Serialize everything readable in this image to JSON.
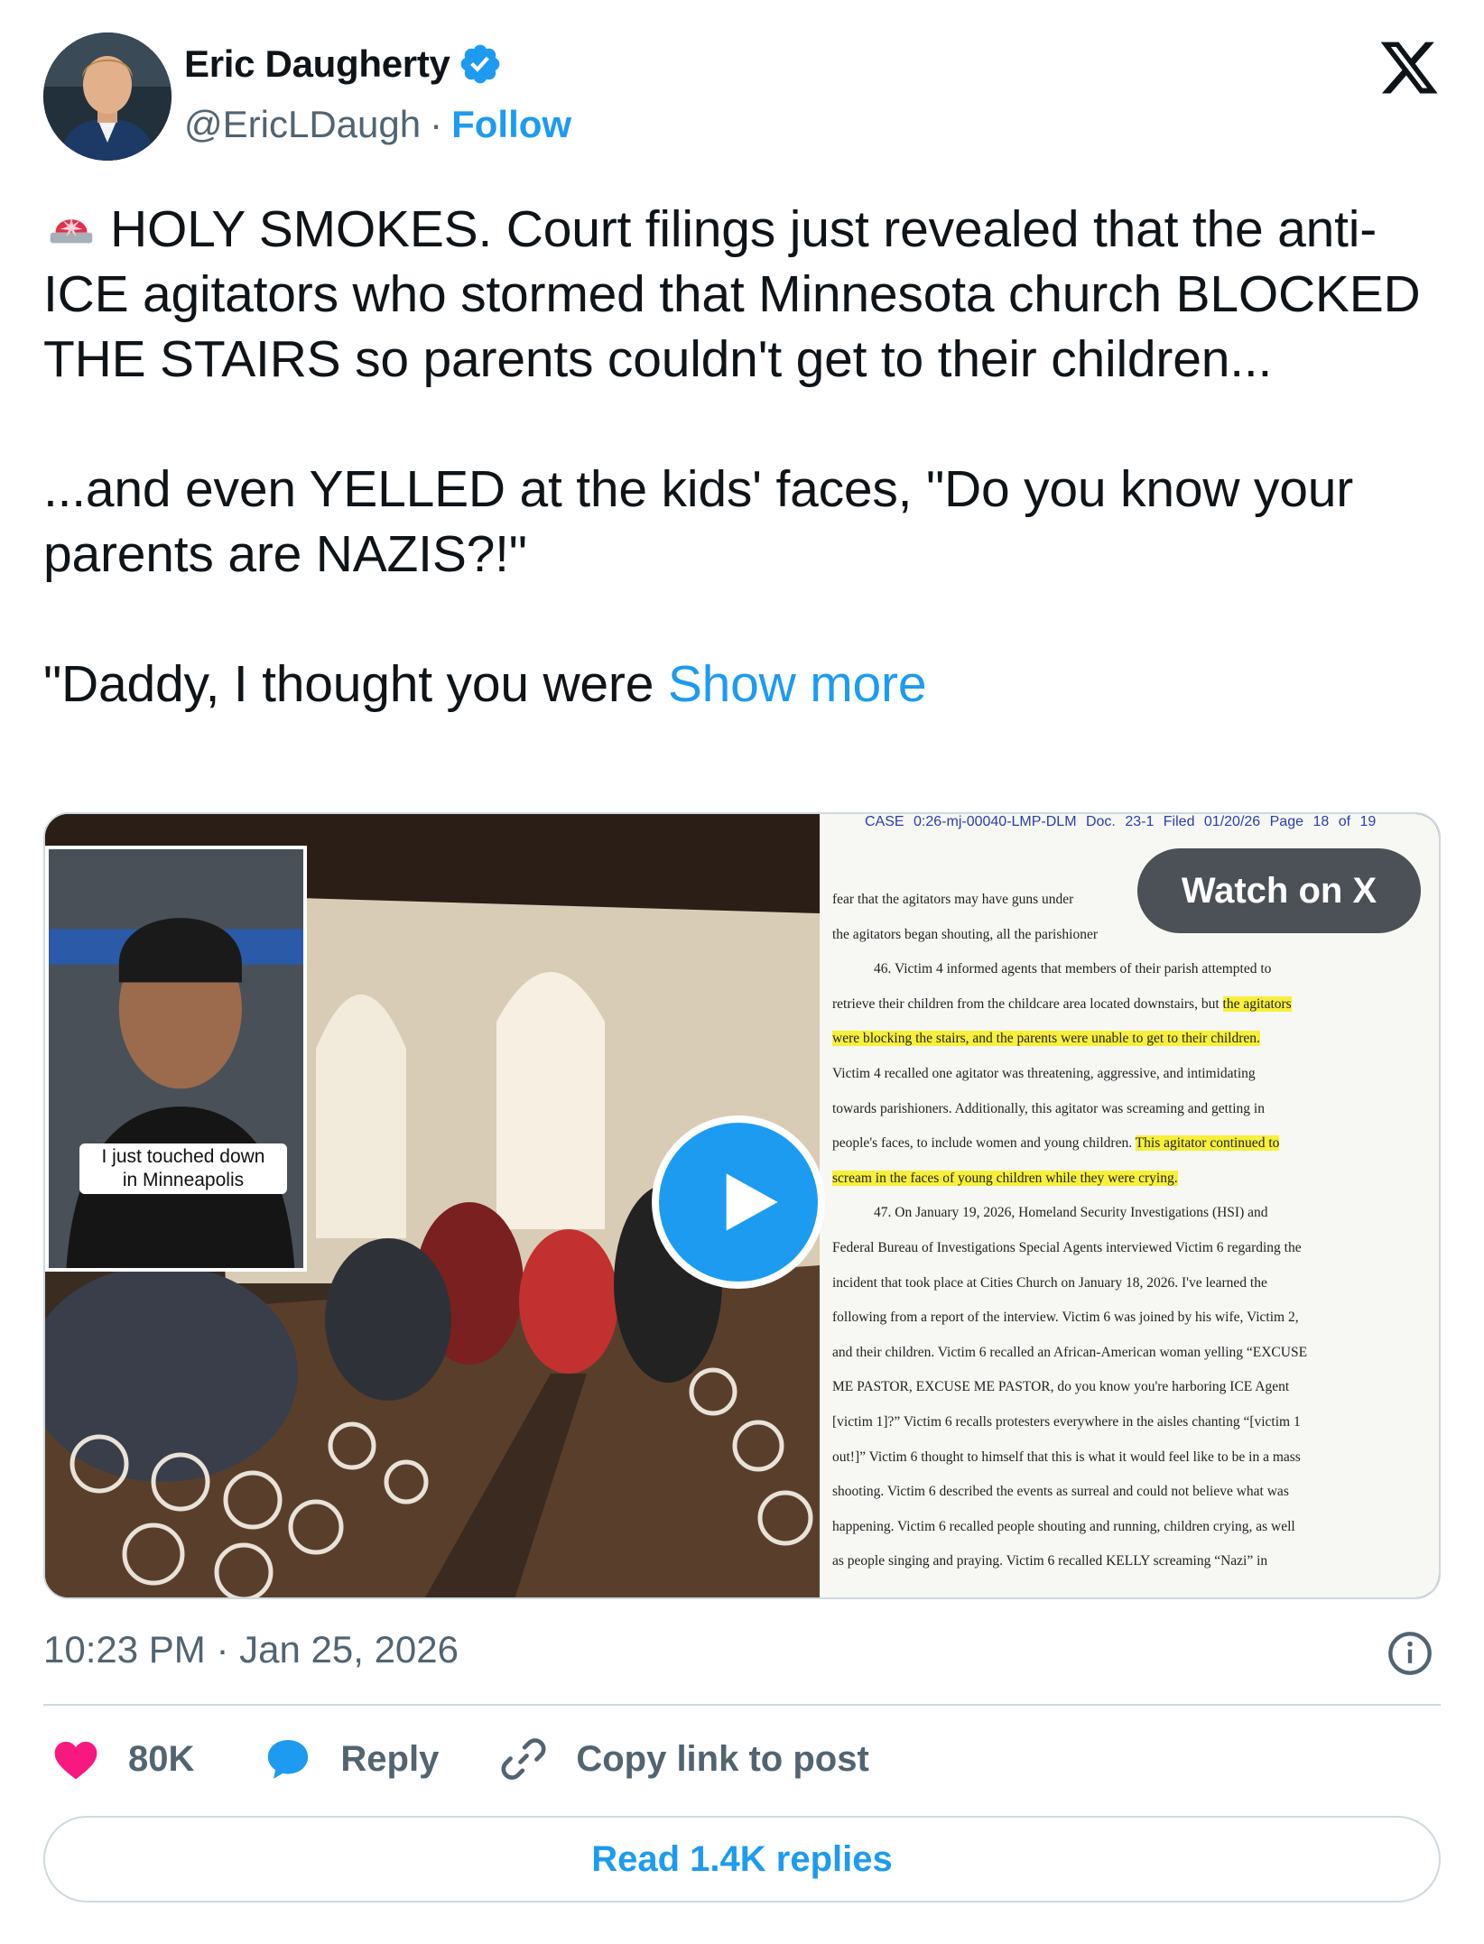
{
  "author": {
    "display_name": "Eric Daugherty",
    "handle": "@EricLDaugh",
    "separator": "·",
    "follow_label": "Follow"
  },
  "icons": {
    "verified": "verified-badge-icon",
    "platform": "x-logo-icon",
    "siren": "police-light-icon",
    "info": "info-icon",
    "like": "heart-icon",
    "reply": "speech-bubble-icon",
    "copy": "link-icon"
  },
  "colors": {
    "accent": "#1d9bf0",
    "text": "#0f1419",
    "muted": "#536471",
    "like": "#f91880",
    "highlight": "#f6f03a",
    "border": "#cfd9de"
  },
  "tweet": {
    "line1": "HOLY SMOKES. Court filings just revealed that the anti-ICE agitators who stormed that Minnesota church BLOCKED THE STAIRS so parents couldn't get to their children...",
    "line2": "...and even YELLED at the kids' faces, \"Do you know your parents are NAZIS?!\"",
    "line3": "\"Daddy, I thought you were ",
    "show_more": "Show more"
  },
  "media": {
    "inset_caption_1": "I just touched down",
    "inset_caption_2": "in Minneapolis",
    "watch_label": "Watch on X",
    "doc_header": "CASE 0:26-mj-00040-LMP-DLM   Doc. 23-1   Filed 01/20/26   Page 18 of 19",
    "doc_lines": [
      "fear that the agitators may have guns under",
      "the agitators began shouting, all the parishioner",
      "46.    Victim 4 informed agents that members of their parish attempted to",
      "retrieve their children from the childcare area located downstairs, but ",
      "the agitators",
      "were blocking the stairs, and the parents were unable to get to their children.",
      "Victim 4 recalled one agitator was threatening, aggressive, and intimidating",
      "towards parishioners.  Additionally, this agitator was screaming and getting in",
      "people's faces, to include women and young children.  ",
      "This agitator continued to",
      "scream in the faces of young children while they were crying.",
      "47.    On January 19, 2026, Homeland Security Investigations (HSI) and",
      "Federal Bureau of Investigations Special Agents interviewed Victim 6 regarding the",
      "incident that took place at Cities Church on January 18, 2026.  I've learned the",
      "following from a report of the interview.  Victim 6 was joined by his wife, Victim 2,",
      "and their children.  Victim 6 recalled an African-American woman yelling “EXCUSE",
      "ME PASTOR, EXCUSE ME PASTOR, do you know you're harboring ICE Agent",
      "[victim 1]?”  Victim 6 recalls protesters everywhere in the aisles chanting “[victim 1",
      "out!]”  Victim 6 thought to himself that this is what it would feel like to be in a mass",
      "shooting.  Victim 6 described the events as surreal and could not believe what was",
      "happening.  Victim 6 recalled people shouting and running, children crying, as well",
      "as people singing and praying.  Victim 6 recalled KELLY screaming “Nazi” in"
    ]
  },
  "footer": {
    "time": "10:23 PM",
    "separator": "·",
    "date": "Jan 25, 2026",
    "like_count": "80K",
    "reply_label": "Reply",
    "copy_label": "Copy link to post",
    "read_replies": "Read 1.4K replies"
  }
}
